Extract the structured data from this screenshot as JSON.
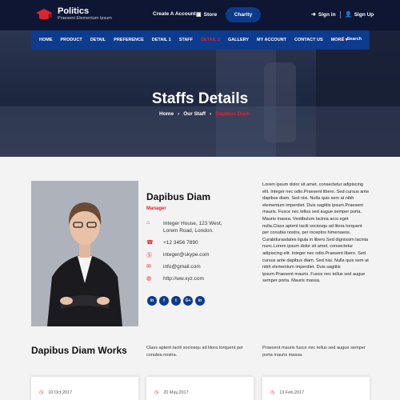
{
  "brand": {
    "title": "Politics",
    "subtitle": "Praesent Elementum Ipsum"
  },
  "topbar": {
    "create_account": "Create A Account",
    "store": "Store",
    "charity": "Charity",
    "sign_in": "Sign in",
    "sign_up": "Sign Up"
  },
  "nav": {
    "items": [
      "HOME",
      "PRODUCT",
      "DETAIL",
      "PREFERENCE",
      "DETAIL 1",
      "STAFF",
      "DETAIL 2",
      "GALLERY",
      "MY ACCOUNT",
      "CONTACT US",
      "MORE"
    ],
    "active_index": 6,
    "search": "Search"
  },
  "hero": {
    "title": "Staffs Details",
    "breadcrumb": [
      "Home",
      "Our Staff",
      "Dapibus Diam"
    ]
  },
  "profile": {
    "name": "Dapibus Diam",
    "role": "Manager",
    "address": "Integer House, 123 West, Lorem Road, London.",
    "phone": "+12 3456 7890",
    "skype": "integer@skype.com",
    "email": "info@gmail.com",
    "website": "http://ww.xyz.com",
    "socials": [
      "in",
      "f",
      "t",
      "G+",
      "in"
    ]
  },
  "bio": "Lorem ipsum dolor sit amet, consectetur adipiscing elit. Integer nec odio.Praesent libero. Sed cursus ante dapibus diam. Sed nisi. Nulla quis sem at nibh elementum imperdiet. Duis sagittis ipsum.Praesent mauris. Fusce nec tellus sed augue semper porta. Mauris massa. Vestibulum lacinia arcu eget nulla.Class aptent taciti sociosqu ad litora torquent per conubia nostra, per inceptos himenaeos. Curabiturasdates ligula in libero.Sed dignissim lacinia nunc.Lorem ipsum dolor sit amet, consectetur adipiscing elit. Integer nec odio.Praesent libero. Sed cursus ante dapibus diam. Sed nisi. Nulla quis sem at nibh elementum imperdiet. Duis sagittis ipsum.Praesent mauris. Fusce nec tellus sed augue semper porta. Mauris massa.",
  "works": {
    "title": "Dapibus Diam Works",
    "col1": "Class aptent taciti sociosqu ad litora torquent per conubia nostra.",
    "col2": "Praesent mauris fusce nec tellus sed augue semper porta mauris massa.",
    "cards": [
      {
        "date": "10 Oct,2017"
      },
      {
        "date": "20 May,2017"
      },
      {
        "date": "13 Feb,2017"
      }
    ]
  },
  "colors": {
    "navy": "#0e1633",
    "nav_blue": "#0d3b8e",
    "accent_red": "#e0242f"
  }
}
